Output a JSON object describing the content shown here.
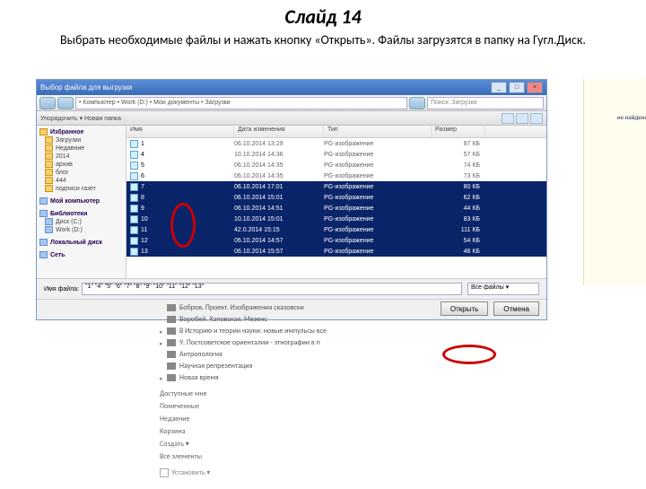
{
  "slide": {
    "title": "Слайд 14",
    "desc": "Выбрать необходимые файлы и нажать кнопку «Открыть». Файлы загрузятся в папку на Гугл.Диск."
  },
  "dialog": {
    "title": "Выбор файла для выгрузки",
    "breadcrumb": "• Компьютер • Work (D:) • Мои документы • Загрузки",
    "searchPlaceholder": "Поиск: Загрузки",
    "toolLeft": "Упорядочить ▾   Новая папка",
    "sidebar": {
      "fav": "Избранное",
      "favItems": [
        "Загрузки",
        "Недавние",
        "2014",
        "архив",
        "блог",
        "444",
        "подписи газет"
      ],
      "comp": "Мой компьютер",
      "libs": "Библиотеки",
      "compItems": [
        "Диск (C:)",
        "Work (D:)"
      ],
      "drive": "Локальный диск",
      "net": "Сеть"
    },
    "cols": {
      "name": "Имя",
      "date": "Дата изменения",
      "type": "Тип",
      "size": "Размер"
    },
    "rows": [
      {
        "n": "1",
        "d": "06.10.2014 13:29",
        "t": "PG-изображение",
        "s": "87 КБ",
        "sel": false
      },
      {
        "n": "4",
        "d": "10.10.2014 14:36",
        "t": "PG-изображение",
        "s": "57 КБ",
        "sel": false
      },
      {
        "n": "5",
        "d": "06.10.2014 14:35",
        "t": "PG-изображение",
        "s": "74 КБ",
        "sel": false
      },
      {
        "n": "6",
        "d": "06.10.2014 14:35",
        "t": "PG-изображение",
        "s": "73 КБ",
        "sel": false
      },
      {
        "n": "7",
        "d": "06.10.2014 17:01",
        "t": "PG-изображение",
        "s": "80 КБ",
        "sel": true
      },
      {
        "n": "8",
        "d": "06.10.2014 15:01",
        "t": "PG-изображение",
        "s": "62 КБ",
        "sel": true
      },
      {
        "n": "9",
        "d": "06.10.2014 14:51",
        "t": "PG-изображение",
        "s": "44 КБ",
        "sel": true
      },
      {
        "n": "10",
        "d": "10.10.2014 15:01",
        "t": "PG-изображение",
        "s": "83 КБ",
        "sel": true
      },
      {
        "n": "11",
        "d": "42.0.2014 15:15",
        "t": "PG-изображение",
        "s": "111 КБ",
        "sel": true
      },
      {
        "n": "12",
        "d": "06.10.2014 14:57",
        "t": "PG-изображение",
        "s": "54 КБ",
        "sel": true
      },
      {
        "n": "13",
        "d": "06.10.2014 15:57",
        "t": "PG-изображение",
        "s": "46 КБ",
        "sel": true
      }
    ],
    "fnameLabel": "Имя файла:",
    "fnameValue": "\"1\" \"4\" \"5\" \"6\" \"7\" \"8\" \"9\" \"10\" \"11\" \"12\" \"13\"",
    "filter": "Все файлы",
    "open": "Открыть",
    "cancel": "Отмена",
    "rightLink": "не найдено Закрыть"
  },
  "gd": {
    "items": [
      {
        "arrow": "",
        "t": "Бобров. Проект. Изображения сказовски"
      },
      {
        "arrow": "",
        "t": "Воробей. Хаповская. Мезенс"
      },
      {
        "arrow": "▸",
        "t": "В Историю и теории науки: новые импульсы все"
      },
      {
        "arrow": "▸",
        "t": "9. Постсоветское ориенталии - этнографии в п"
      },
      {
        "arrow": "",
        "t": "Антропология"
      },
      {
        "arrow": "",
        "t": "Научная репрезентация"
      },
      {
        "arrow": "▸",
        "t": "Новая время"
      }
    ],
    "sub": [
      "Доступные мне",
      "Помеченные",
      "Недавние",
      "Корзина",
      "Создать ▾",
      "Все элементы"
    ],
    "foot": "Установить ▾"
  }
}
